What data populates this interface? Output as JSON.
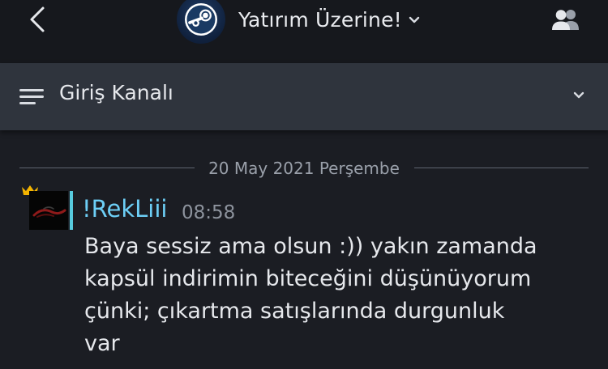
{
  "header": {
    "back_icon": "chevron-left-icon",
    "group_icon": "steam-logo-icon",
    "group_name": "Yatırım Üzerine!",
    "members_icon": "users-icon"
  },
  "channel": {
    "menu_icon": "hamburger-menu-icon",
    "name": "Giriş Kanalı",
    "dropdown_icon": "chevron-down-icon"
  },
  "chat": {
    "date_divider": "20 May 2021 Perşembe",
    "messages": [
      {
        "author": "!RekLiii",
        "time": "08:58",
        "badge_icon": "crown-icon",
        "badge_color": "#f4b400",
        "status_color": "#57cbde",
        "author_color": "#6dcff6",
        "lines": [
          "Baya sessiz ama olsun :)) yakın zamanda",
          "kapsül indirimin biteceğini düşünüyorum",
          "çünki; çıkartma satışlarında durgunluk",
          "var"
        ]
      }
    ]
  },
  "colors": {
    "background": "#1b1d23",
    "header_bg": "#16181d",
    "channel_bar_bg": "#2f343d"
  }
}
